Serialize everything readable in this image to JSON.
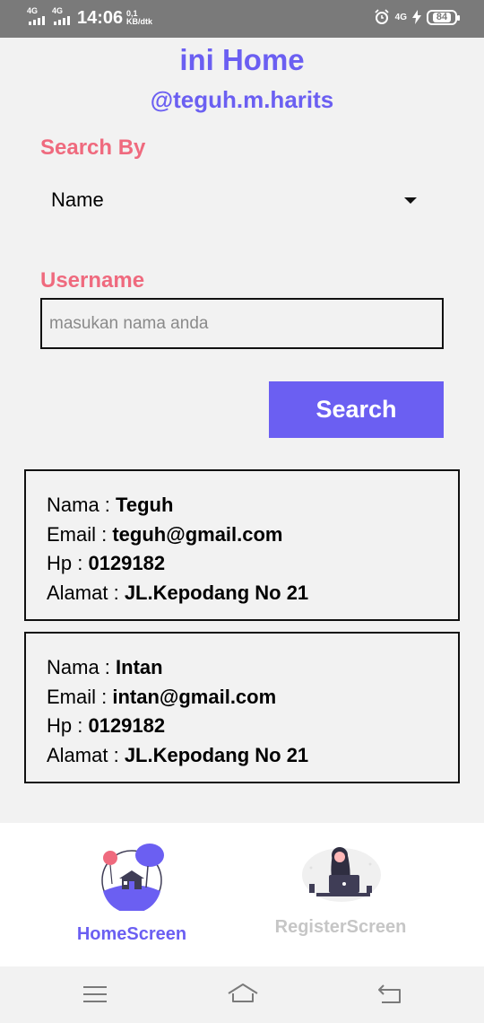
{
  "status_bar": {
    "net1": "4G",
    "net2": "4G",
    "time": "14:06",
    "speed_value": "0,1",
    "speed_unit": "KB/dtk",
    "volte": "4G",
    "battery": "84"
  },
  "header": {
    "title": "ini Home",
    "subtitle": "@teguh.m.harits"
  },
  "search_by": {
    "label": "Search By",
    "selected": "Name"
  },
  "username": {
    "label": "Username",
    "value": "",
    "placeholder": "masukan nama anda"
  },
  "search_button": {
    "label": "Search"
  },
  "users": [
    {
      "nama_label": "Nama : ",
      "nama": "Teguh",
      "email_label": "Email : ",
      "email": "teguh@gmail.com",
      "hp_label": "Hp : ",
      "hp": "0129182",
      "alamat_label": "Alamat : ",
      "alamat": "JL.Kepodang No 21"
    },
    {
      "nama_label": "Nama : ",
      "nama": "Intan",
      "email_label": "Email : ",
      "email": "intan@gmail.com",
      "hp_label": "Hp : ",
      "hp": "0129182",
      "alamat_label": "Alamat : ",
      "alamat": "JL.Kepodang No 21"
    }
  ],
  "bottom_nav": {
    "home": {
      "label": "HomeScreen",
      "color": "#6b5ff2",
      "icon": "home-illustration"
    },
    "register": {
      "label": "RegisterScreen",
      "color": "#c6c6c6",
      "icon": "laptop-person-illustration"
    }
  },
  "colors": {
    "accent": "#6b5ff2",
    "label_pink": "#ef6a7e",
    "background": "#f2f2f2"
  }
}
